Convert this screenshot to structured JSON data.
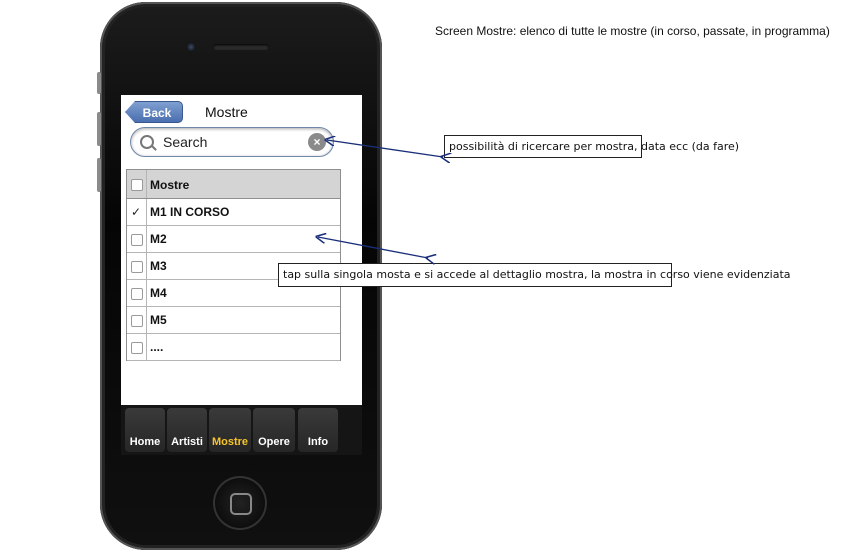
{
  "caption": "Screen Mostre: elenco di tutte le mostre (in corso, passate, in programma)",
  "nav": {
    "back_label": "Back",
    "title": "Mostre"
  },
  "search": {
    "placeholder": "Search"
  },
  "table": {
    "header": "Mostre",
    "rows": [
      {
        "label": "M1 IN CORSO",
        "checked": true
      },
      {
        "label": "M2",
        "checked": false
      },
      {
        "label": "M3",
        "checked": false
      },
      {
        "label": "M4",
        "checked": false
      },
      {
        "label": "M5",
        "checked": false
      },
      {
        "label": "....",
        "checked": false
      }
    ]
  },
  "tabbar": {
    "tabs": [
      {
        "label": "Home",
        "active": false
      },
      {
        "label": "Artisti",
        "active": false
      },
      {
        "label": "Mostre",
        "active": true
      },
      {
        "label": "Opere",
        "active": false
      },
      {
        "label": "Info",
        "active": false
      }
    ]
  },
  "annotations": {
    "search_note": "possibilità di ricercare per mostra, data ecc (da fare)",
    "list_note": "tap sulla singola mosta e si accede al dettaglio mostra, la mostra in corso viene evidenziata"
  },
  "colors": {
    "active_tab": "#f7c52b",
    "back_button": "#4a6fb0",
    "arrow": "#1a2f7a"
  },
  "checkmark_glyph": "✓",
  "icons": [
    "search-icon",
    "clear-icon",
    "home-button-icon"
  ]
}
